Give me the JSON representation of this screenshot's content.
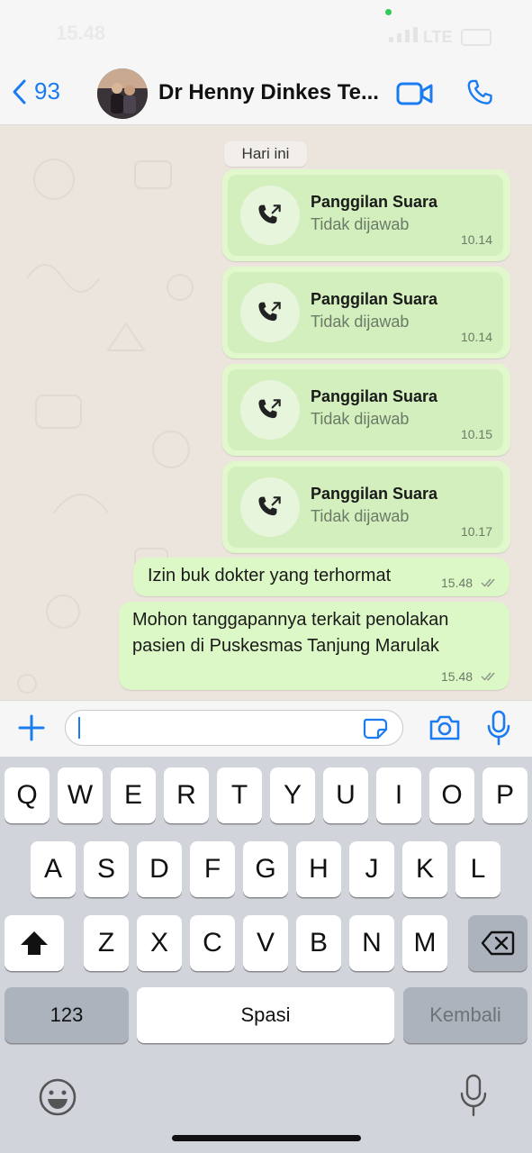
{
  "status": {
    "time": "15.48",
    "network": "LTE"
  },
  "header": {
    "back_count": "93",
    "title": "Dr Henny Dinkes Te..."
  },
  "date_chip": "Hari ini",
  "calls": [
    {
      "title": "Panggilan Suara",
      "status": "Tidak dijawab",
      "time": "10.14"
    },
    {
      "title": "Panggilan Suara",
      "status": "Tidak dijawab",
      "time": "10.14"
    },
    {
      "title": "Panggilan Suara",
      "status": "Tidak dijawab",
      "time": "10.15"
    },
    {
      "title": "Panggilan Suara",
      "status": "Tidak dijawab",
      "time": "10.17"
    }
  ],
  "messages": [
    {
      "lines": [
        "Izin buk dokter yang terhormat"
      ],
      "time": "15.48"
    },
    {
      "lines": [
        "Mohon tanggapannya terkait penolakan",
        "pasien di Puskesmas Tanjung Marulak"
      ],
      "time": "15.48"
    }
  ],
  "keyboard": {
    "row1": [
      "Q",
      "W",
      "E",
      "R",
      "T",
      "Y",
      "U",
      "I",
      "O",
      "P"
    ],
    "row2": [
      "A",
      "S",
      "D",
      "F",
      "G",
      "H",
      "J",
      "K",
      "L"
    ],
    "row3": [
      "Z",
      "X",
      "C",
      "V",
      "B",
      "N",
      "M"
    ],
    "numbers": "123",
    "space": "Spasi",
    "return": "Kembali"
  },
  "colors": {
    "accent": "#1b7cf2",
    "bubble": "#dcf8c6"
  }
}
